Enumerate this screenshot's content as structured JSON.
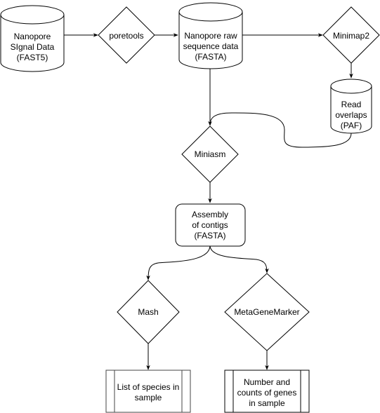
{
  "diagram": {
    "type": "flowchart",
    "nodes": {
      "signal_data": {
        "shape": "cylinder",
        "lines": [
          "Nanopore",
          "SIgnal Data",
          "(FAST5)"
        ]
      },
      "poretools": {
        "shape": "decision",
        "lines": [
          "poretools"
        ]
      },
      "raw_sequence": {
        "shape": "cylinder",
        "lines": [
          "Nanopore raw",
          "sequence data",
          "(FASTA)"
        ]
      },
      "minimap2": {
        "shape": "decision",
        "lines": [
          "Minimap2"
        ]
      },
      "read_overlaps": {
        "shape": "cylinder",
        "lines": [
          "Read",
          "overlaps",
          "(PAF)"
        ]
      },
      "miniasm": {
        "shape": "decision",
        "lines": [
          "Miniasm"
        ]
      },
      "assembly": {
        "shape": "rounded-rectangle",
        "lines": [
          "Assembly",
          "of contigs",
          "(FASTA)"
        ]
      },
      "mash": {
        "shape": "decision",
        "lines": [
          "Mash"
        ]
      },
      "metagenemarker": {
        "shape": "decision",
        "lines": [
          "MetaGeneMarker"
        ]
      },
      "species_list": {
        "shape": "predefined-process",
        "lines": [
          "List of species in",
          "sample"
        ]
      },
      "gene_counts": {
        "shape": "predefined-process",
        "lines": [
          "Number and",
          "counts of genes",
          "in sample"
        ]
      }
    },
    "edges": [
      {
        "from": "signal_data",
        "to": "poretools"
      },
      {
        "from": "poretools",
        "to": "raw_sequence"
      },
      {
        "from": "raw_sequence",
        "to": "minimap2"
      },
      {
        "from": "minimap2",
        "to": "read_overlaps"
      },
      {
        "from": "raw_sequence",
        "to": "miniasm"
      },
      {
        "from": "read_overlaps",
        "to": "miniasm"
      },
      {
        "from": "miniasm",
        "to": "assembly"
      },
      {
        "from": "assembly",
        "to": "mash"
      },
      {
        "from": "assembly",
        "to": "metagenemarker"
      },
      {
        "from": "mash",
        "to": "species_list"
      },
      {
        "from": "metagenemarker",
        "to": "gene_counts"
      }
    ]
  }
}
